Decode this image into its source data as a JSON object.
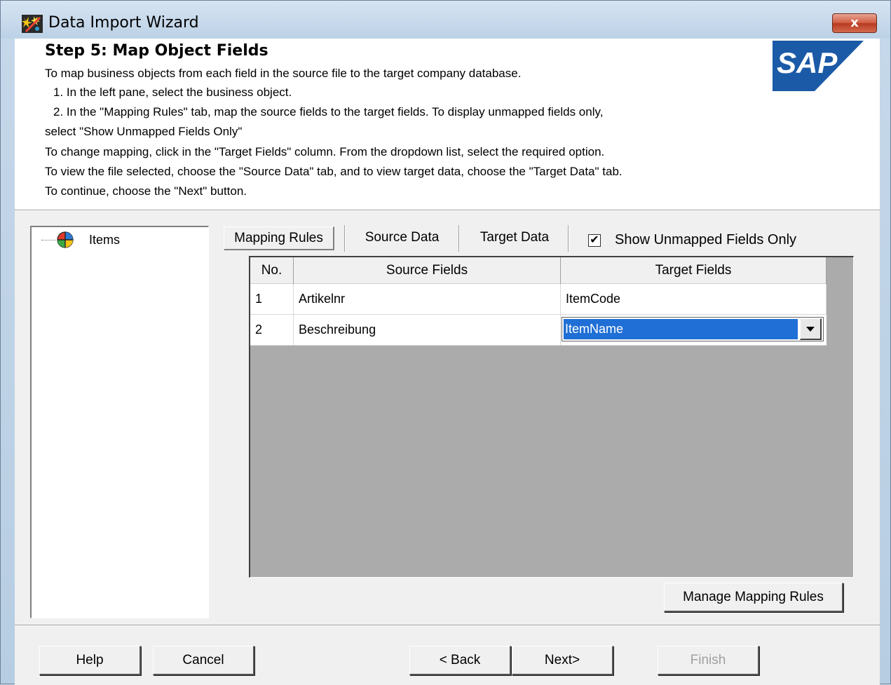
{
  "window": {
    "title": "Data Import Wizard",
    "close_glyph": "x"
  },
  "header": {
    "step_title": "Step 5: Map Object Fields",
    "instructions": [
      "To map business objects from each field in the source file to the target company database.",
      "1. In the left pane, select the business object.",
      "2. In the \"Mapping Rules\" tab, map the source fields to the target fields. To display unmapped fields only,",
      "select \"Show Unmapped Fields Only\"",
      "To change mapping, click in the \"Target Fields\" column. From the dropdown list, select the required option.",
      "To view the file selected, choose the \"Source Data\" tab, and to view target data, choose the \"Target Data\" tab.",
      "To continue, choose the \"Next\" button."
    ],
    "logo_text": "SAP"
  },
  "tree": {
    "items": [
      {
        "label": "Items",
        "icon": "business-object-icon"
      }
    ]
  },
  "tabs": {
    "mapping_rules": "Mapping Rules",
    "source_data": "Source Data",
    "target_data": "Target Data",
    "active": "Mapping Rules"
  },
  "show_unmapped": {
    "label": "Show Unmapped Fields Only",
    "checked": true,
    "check_glyph": "✔"
  },
  "grid": {
    "columns": [
      "No.",
      "Source  Fields",
      "Target Fields"
    ],
    "rows": [
      {
        "no": "1",
        "source": "Artikelnr",
        "target": "ItemCode"
      },
      {
        "no": "2",
        "source": "Beschreibung",
        "target": "ItemName"
      }
    ],
    "dropdown_arrow": "▼"
  },
  "buttons": {
    "manage_mapping_rules": "Manage Mapping Rules",
    "help": "Help",
    "cancel": "Cancel",
    "back": "< Back",
    "next": "Next>",
    "finish": "Finish"
  },
  "colors": {
    "selection": "#1f6fd6",
    "sap_blue": "#1b5aa6",
    "grid_background": "#ababab"
  }
}
